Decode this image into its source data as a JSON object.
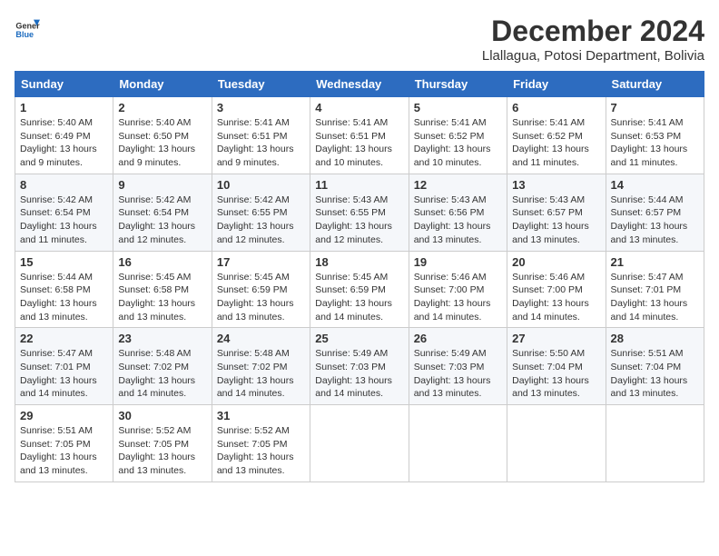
{
  "logo": {
    "general": "General",
    "blue": "Blue"
  },
  "header": {
    "month": "December 2024",
    "location": "Llallagua, Potosi Department, Bolivia"
  },
  "days_of_week": [
    "Sunday",
    "Monday",
    "Tuesday",
    "Wednesday",
    "Thursday",
    "Friday",
    "Saturday"
  ],
  "weeks": [
    [
      {
        "day": "1",
        "sunrise": "5:40 AM",
        "sunset": "6:49 PM",
        "daylight": "13 hours and 9 minutes."
      },
      {
        "day": "2",
        "sunrise": "5:40 AM",
        "sunset": "6:50 PM",
        "daylight": "13 hours and 9 minutes."
      },
      {
        "day": "3",
        "sunrise": "5:41 AM",
        "sunset": "6:51 PM",
        "daylight": "13 hours and 9 minutes."
      },
      {
        "day": "4",
        "sunrise": "5:41 AM",
        "sunset": "6:51 PM",
        "daylight": "13 hours and 10 minutes."
      },
      {
        "day": "5",
        "sunrise": "5:41 AM",
        "sunset": "6:52 PM",
        "daylight": "13 hours and 10 minutes."
      },
      {
        "day": "6",
        "sunrise": "5:41 AM",
        "sunset": "6:52 PM",
        "daylight": "13 hours and 11 minutes."
      },
      {
        "day": "7",
        "sunrise": "5:41 AM",
        "sunset": "6:53 PM",
        "daylight": "13 hours and 11 minutes."
      }
    ],
    [
      {
        "day": "8",
        "sunrise": "5:42 AM",
        "sunset": "6:54 PM",
        "daylight": "13 hours and 11 minutes."
      },
      {
        "day": "9",
        "sunrise": "5:42 AM",
        "sunset": "6:54 PM",
        "daylight": "13 hours and 12 minutes."
      },
      {
        "day": "10",
        "sunrise": "5:42 AM",
        "sunset": "6:55 PM",
        "daylight": "13 hours and 12 minutes."
      },
      {
        "day": "11",
        "sunrise": "5:43 AM",
        "sunset": "6:55 PM",
        "daylight": "13 hours and 12 minutes."
      },
      {
        "day": "12",
        "sunrise": "5:43 AM",
        "sunset": "6:56 PM",
        "daylight": "13 hours and 13 minutes."
      },
      {
        "day": "13",
        "sunrise": "5:43 AM",
        "sunset": "6:57 PM",
        "daylight": "13 hours and 13 minutes."
      },
      {
        "day": "14",
        "sunrise": "5:44 AM",
        "sunset": "6:57 PM",
        "daylight": "13 hours and 13 minutes."
      }
    ],
    [
      {
        "day": "15",
        "sunrise": "5:44 AM",
        "sunset": "6:58 PM",
        "daylight": "13 hours and 13 minutes."
      },
      {
        "day": "16",
        "sunrise": "5:45 AM",
        "sunset": "6:58 PM",
        "daylight": "13 hours and 13 minutes."
      },
      {
        "day": "17",
        "sunrise": "5:45 AM",
        "sunset": "6:59 PM",
        "daylight": "13 hours and 13 minutes."
      },
      {
        "day": "18",
        "sunrise": "5:45 AM",
        "sunset": "6:59 PM",
        "daylight": "13 hours and 14 minutes."
      },
      {
        "day": "19",
        "sunrise": "5:46 AM",
        "sunset": "7:00 PM",
        "daylight": "13 hours and 14 minutes."
      },
      {
        "day": "20",
        "sunrise": "5:46 AM",
        "sunset": "7:00 PM",
        "daylight": "13 hours and 14 minutes."
      },
      {
        "day": "21",
        "sunrise": "5:47 AM",
        "sunset": "7:01 PM",
        "daylight": "13 hours and 14 minutes."
      }
    ],
    [
      {
        "day": "22",
        "sunrise": "5:47 AM",
        "sunset": "7:01 PM",
        "daylight": "13 hours and 14 minutes."
      },
      {
        "day": "23",
        "sunrise": "5:48 AM",
        "sunset": "7:02 PM",
        "daylight": "13 hours and 14 minutes."
      },
      {
        "day": "24",
        "sunrise": "5:48 AM",
        "sunset": "7:02 PM",
        "daylight": "13 hours and 14 minutes."
      },
      {
        "day": "25",
        "sunrise": "5:49 AM",
        "sunset": "7:03 PM",
        "daylight": "13 hours and 14 minutes."
      },
      {
        "day": "26",
        "sunrise": "5:49 AM",
        "sunset": "7:03 PM",
        "daylight": "13 hours and 13 minutes."
      },
      {
        "day": "27",
        "sunrise": "5:50 AM",
        "sunset": "7:04 PM",
        "daylight": "13 hours and 13 minutes."
      },
      {
        "day": "28",
        "sunrise": "5:51 AM",
        "sunset": "7:04 PM",
        "daylight": "13 hours and 13 minutes."
      }
    ],
    [
      {
        "day": "29",
        "sunrise": "5:51 AM",
        "sunset": "7:05 PM",
        "daylight": "13 hours and 13 minutes."
      },
      {
        "day": "30",
        "sunrise": "5:52 AM",
        "sunset": "7:05 PM",
        "daylight": "13 hours and 13 minutes."
      },
      {
        "day": "31",
        "sunrise": "5:52 AM",
        "sunset": "7:05 PM",
        "daylight": "13 hours and 13 minutes."
      },
      null,
      null,
      null,
      null
    ]
  ],
  "labels": {
    "sunrise": "Sunrise:",
    "sunset": "Sunset:",
    "daylight": "Daylight:"
  }
}
